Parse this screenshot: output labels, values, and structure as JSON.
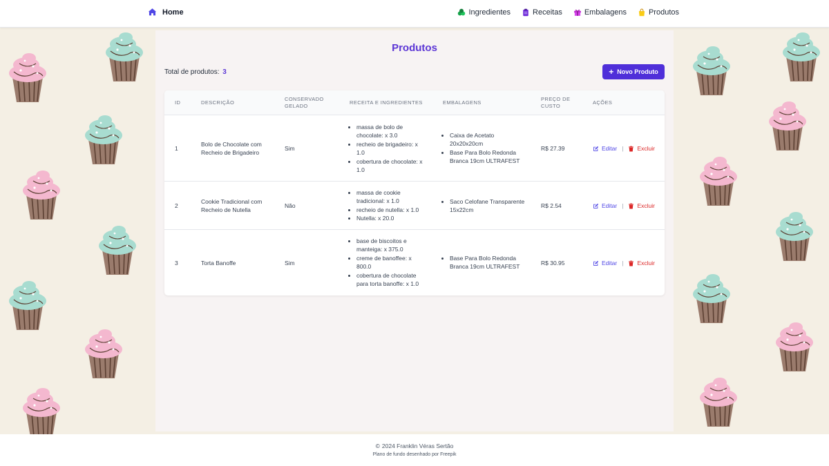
{
  "nav": {
    "home_label": "Home",
    "links": [
      {
        "label": "Ingredientes",
        "icon": "leaf-icon",
        "color": "#16a34a"
      },
      {
        "label": "Receitas",
        "icon": "clipboard-icon",
        "color": "#6d28d9"
      },
      {
        "label": "Embalagens",
        "icon": "gift-icon",
        "color": "#c026d3"
      },
      {
        "label": "Produtos",
        "icon": "shopping-bag-icon",
        "color": "#eab308"
      }
    ]
  },
  "page": {
    "title": "Produtos",
    "total_label": "Total de produtos:",
    "total_count": "3",
    "new_button_label": "Novo Produto"
  },
  "table": {
    "headers": {
      "id": "ID",
      "descricao": "Descrição",
      "conservado_1": "Conservado",
      "conservado_2": "Gelado",
      "receita": "Receita e Ingredientes",
      "embalagens": "Embalagens",
      "preco_1": "Preço de",
      "preco_2": "Custo",
      "acoes": "Ações"
    },
    "edit_label": "Editar",
    "delete_label": "Excluir",
    "separator": "|",
    "rows": [
      {
        "id": "1",
        "descricao": "Bolo de Chocolate com Recheio de Brigadeiro",
        "conservado": "Sim",
        "ingredientes": [
          "massa de bolo de chocolate: x 3.0",
          "recheio de brigadeiro: x 1.0",
          "cobertura de chocolate: x 1.0"
        ],
        "embalagens": [
          "Caixa de Acetato 20x20x20cm",
          "Base Para Bolo Redonda Branca 19cm ULTRAFEST"
        ],
        "preco": "R$ 27.39"
      },
      {
        "id": "2",
        "descricao": "Cookie Tradicional com Recheio de Nutella",
        "conservado": "Não",
        "ingredientes": [
          "massa de cookie tradicional: x 1.0",
          "recheio de nutella: x 1.0",
          "Nutella: x 20.0"
        ],
        "embalagens": [
          "Saco Celofane Transparente 15x22cm"
        ],
        "preco": "R$ 2.54"
      },
      {
        "id": "3",
        "descricao": "Torta Banoffe",
        "conservado": "Sim",
        "ingredientes": [
          "base de biscoitos e manteiga: x 375.0",
          "creme de banoffee: x 800.0",
          "cobertura de chocolate para torta banoffe: x 1.0"
        ],
        "embalagens": [
          "Base Para Bolo Redonda Branca 19cm ULTRAFEST"
        ],
        "preco": "R$ 30.95"
      }
    ]
  },
  "footer": {
    "copyright": "2024 Franklin Véras Sertão",
    "credit": "Plano de fundo desenhado por Freepik"
  },
  "colors": {
    "accent": "#4f2fd9",
    "title": "#5b35d5",
    "edit": "#4f46e5",
    "delete": "#dc2626",
    "background": "#f4efe4"
  }
}
